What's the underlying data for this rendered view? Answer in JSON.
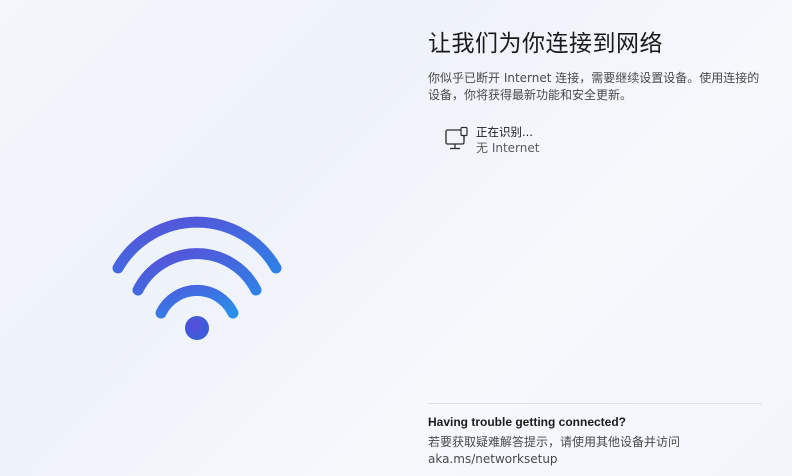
{
  "page": {
    "title": "让我们为你连接到网络",
    "description": "你似乎已断开 Internet 连接，需要继续设置设备。使用连接的设备，你将获得最新功能和安全更新。"
  },
  "network": {
    "icon": "wired-network-icon",
    "status": "正在识别...",
    "subtitle": "无 Internet"
  },
  "illustration": {
    "icon": "wifi-icon",
    "colors": {
      "outer": "#4a6ee0",
      "inner": "#3a8fe6",
      "dot": "#3d55d6"
    }
  },
  "help": {
    "title": "Having trouble getting connected?",
    "text": "若要获取疑难解答提示，请使用其他设备并访问 aka.ms/networksetup"
  }
}
